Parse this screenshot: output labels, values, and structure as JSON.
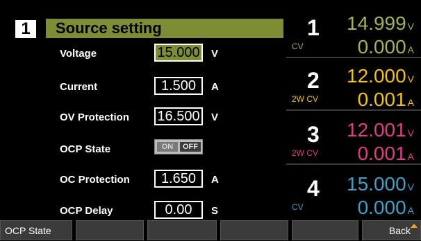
{
  "header": {
    "channel_num": "1",
    "title": "Source setting"
  },
  "settings": {
    "rows": [
      {
        "label": "Voltage",
        "value": "15.000",
        "unit": "V",
        "type": "input",
        "active": true
      },
      {
        "label": "Current",
        "value": "1.500",
        "unit": "A",
        "type": "input"
      },
      {
        "label": "OV Protection",
        "value": "16.500",
        "unit": "V",
        "type": "input"
      },
      {
        "label": "OCP State",
        "type": "toggle",
        "on_label": "ON",
        "off_label": "OFF",
        "selected": "OFF"
      },
      {
        "label": "OC Protection",
        "value": "1.650",
        "unit": "A",
        "type": "input"
      },
      {
        "label": "OCP Delay",
        "value": "0.00",
        "unit": "S",
        "type": "input"
      }
    ]
  },
  "channels": [
    {
      "num": "1",
      "mode": "CV",
      "mode_color": "#a3b34e",
      "voltage": "14.999",
      "voltage_color": "#a3b34e",
      "current": "0.000",
      "current_color": "#a3b34e"
    },
    {
      "num": "2",
      "mode": "2W CV",
      "mode_color": "#f5c400",
      "voltage": "12.000",
      "voltage_color": "#f5c400",
      "current": "0.001",
      "current_color": "#f5c400"
    },
    {
      "num": "3",
      "mode": "2W CV",
      "mode_color": "#e43a86",
      "voltage": "12.001",
      "voltage_color": "#e43a86",
      "current": "0.001",
      "current_color": "#e43a86"
    },
    {
      "num": "4",
      "mode": "CV",
      "mode_color": "#3ca0c8",
      "voltage": "15.000",
      "voltage_color": "#3ca0c8",
      "current": "0.000",
      "current_color": "#3ca0c8"
    }
  ],
  "units": {
    "volt": "V",
    "amp": "A"
  },
  "softkeys": [
    "OCP State",
    "",
    "",
    "",
    "",
    "Back"
  ],
  "colors": {
    "accent_green": "#7d8d34",
    "softkey_bg": "#3b3b3b",
    "arrow": "#f2a320"
  }
}
